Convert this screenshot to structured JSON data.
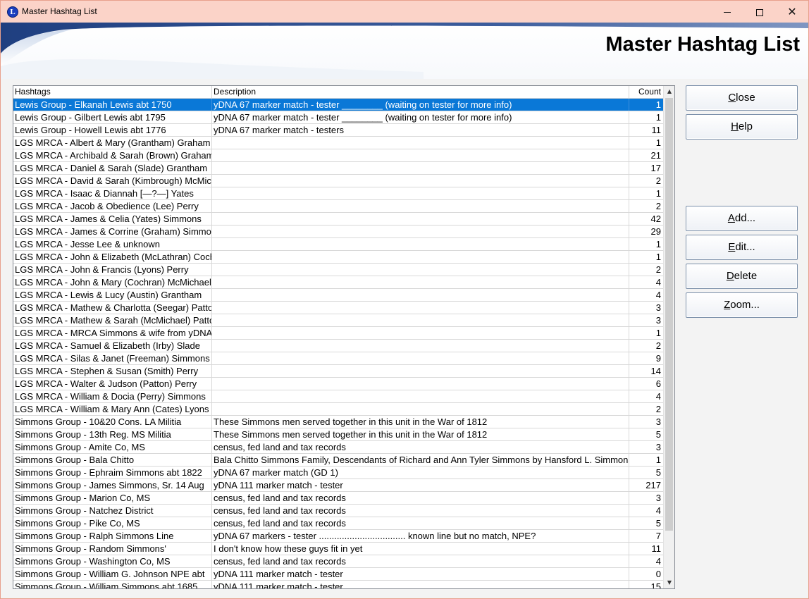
{
  "window": {
    "title": "Master Hashtag List",
    "icon_letter": "L"
  },
  "heading": "Master Hashtag List",
  "columns": {
    "hashtags": "Hashtags",
    "description": "Description",
    "count": "Count"
  },
  "rows": [
    {
      "tag": "Lewis Group - Elkanah Lewis abt 1750",
      "desc": "yDNA 67 marker match - tester ________ (waiting on tester for more info)",
      "count": "1"
    },
    {
      "tag": "Lewis Group - Gilbert Lewis abt 1795",
      "desc": "yDNA 67 marker match - tester ________ (waiting on tester for more info)",
      "count": "1"
    },
    {
      "tag": "Lewis Group - Howell Lewis abt 1776",
      "desc": "yDNA 67 marker match - testers",
      "count": "11"
    },
    {
      "tag": "LGS MRCA - Albert & Mary (Grantham) Graham",
      "desc": "",
      "count": "1"
    },
    {
      "tag": "LGS MRCA - Archibald & Sarah (Brown) Graham",
      "desc": "",
      "count": "21"
    },
    {
      "tag": "LGS MRCA - Daniel & Sarah (Slade) Grantham",
      "desc": "",
      "count": "17"
    },
    {
      "tag": "LGS MRCA - David & Sarah (Kimbrough) McMichael",
      "desc": "",
      "count": "2"
    },
    {
      "tag": "LGS MRCA - Isaac & Diannah [—?—] Yates",
      "desc": "",
      "count": "1"
    },
    {
      "tag": "LGS MRCA - Jacob & Obedience (Lee) Perry",
      "desc": "",
      "count": "2"
    },
    {
      "tag": "LGS MRCA - James & Celia (Yates) Simmons",
      "desc": "",
      "count": "42"
    },
    {
      "tag": "LGS MRCA - James & Corrine (Graham) Simmons",
      "desc": "",
      "count": "29"
    },
    {
      "tag": "LGS MRCA - Jesse Lee & unknown",
      "desc": "",
      "count": "1"
    },
    {
      "tag": "LGS MRCA - John & Elizabeth (McLathran) Cochran",
      "desc": "",
      "count": "1"
    },
    {
      "tag": "LGS MRCA - John & Francis (Lyons) Perry",
      "desc": "",
      "count": "2"
    },
    {
      "tag": "LGS MRCA - John & Mary (Cochran) McMichael",
      "desc": "",
      "count": "4"
    },
    {
      "tag": "LGS MRCA - Lewis & Lucy (Austin) Grantham",
      "desc": "",
      "count": "4"
    },
    {
      "tag": "LGS MRCA - Mathew & Charlotta (Seegar) Patton",
      "desc": "",
      "count": "3"
    },
    {
      "tag": "LGS MRCA - Mathew & Sarah (McMichael) Patton",
      "desc": "",
      "count": "3"
    },
    {
      "tag": "LGS MRCA - MRCA Simmons & wife from yDNA",
      "desc": "",
      "count": "1"
    },
    {
      "tag": "LGS MRCA - Samuel & Elizabeth (Irby) Slade",
      "desc": "",
      "count": "2"
    },
    {
      "tag": "LGS MRCA - Silas & Janet (Freeman) Simmons",
      "desc": "",
      "count": "9"
    },
    {
      "tag": "LGS MRCA - Stephen & Susan (Smith) Perry",
      "desc": "",
      "count": "14"
    },
    {
      "tag": "LGS MRCA - Walter & Judson (Patton) Perry",
      "desc": "",
      "count": "6"
    },
    {
      "tag": "LGS MRCA - William & Docia (Perry) Simmons",
      "desc": "",
      "count": "4"
    },
    {
      "tag": "LGS MRCA - William & Mary Ann (Cates) Lyons",
      "desc": "",
      "count": "2"
    },
    {
      "tag": "Simmons Group - 10&20 Cons. LA Militia",
      "desc": "These Simmons men served together in this unit in the War of 1812",
      "count": "3"
    },
    {
      "tag": "Simmons Group - 13th Reg. MS Militia",
      "desc": "These Simmons men served together in this unit in the War of 1812",
      "count": "5"
    },
    {
      "tag": "Simmons Group - Amite Co, MS",
      "desc": "census, fed land and tax records",
      "count": "3"
    },
    {
      "tag": "Simmons Group - Bala Chitto",
      "desc": "Bala Chitto Simmons Family, Descendants of Richard and Ann Tyler Simmons by Hansford L. Simmons",
      "count": "1"
    },
    {
      "tag": "Simmons Group - Ephraim Simmons abt 1822",
      "desc": "yDNA 67 marker match (GD 1)",
      "count": "5"
    },
    {
      "tag": "Simmons Group - James Simmons, Sr. 14 Aug",
      "desc": "yDNA 111 marker match - tester",
      "count": "217"
    },
    {
      "tag": "Simmons Group - Marion Co, MS",
      "desc": "census, fed land and tax records",
      "count": "3"
    },
    {
      "tag": "Simmons Group - Natchez District",
      "desc": "census, fed land and tax records",
      "count": "4"
    },
    {
      "tag": "Simmons Group - Pike Co, MS",
      "desc": "census, fed land and tax records",
      "count": "5"
    },
    {
      "tag": "Simmons Group - Ralph Simmons Line",
      "desc": "yDNA 67 markers - tester ..................................  known line but no match, NPE?",
      "count": "7"
    },
    {
      "tag": "Simmons Group - Random Simmons'",
      "desc": "I don't know how these guys fit in yet",
      "count": "11"
    },
    {
      "tag": "Simmons Group - Washington Co, MS",
      "desc": "census, fed land and tax records",
      "count": "4"
    },
    {
      "tag": "Simmons Group - William G. Johnson NPE abt",
      "desc": "yDNA 111 marker match - tester",
      "count": "0"
    },
    {
      "tag": "Simmons Group - William Simmons abt 1685",
      "desc": "yDNA 111 marker match - tester",
      "count": "15"
    }
  ],
  "buttons": {
    "close": {
      "key": "C",
      "rest": "lose"
    },
    "help": {
      "key": "H",
      "rest": "elp"
    },
    "add": {
      "key": "A",
      "rest": "dd..."
    },
    "edit": {
      "key": "E",
      "rest": "dit..."
    },
    "delete": {
      "key": "D",
      "rest": "elete"
    },
    "zoom": {
      "key": "Z",
      "rest": "oom..."
    }
  },
  "colors": {
    "selection": "#0a78d7",
    "titlebar": "#fbd3c8",
    "banner_swoosh": "#2b4e8f"
  }
}
